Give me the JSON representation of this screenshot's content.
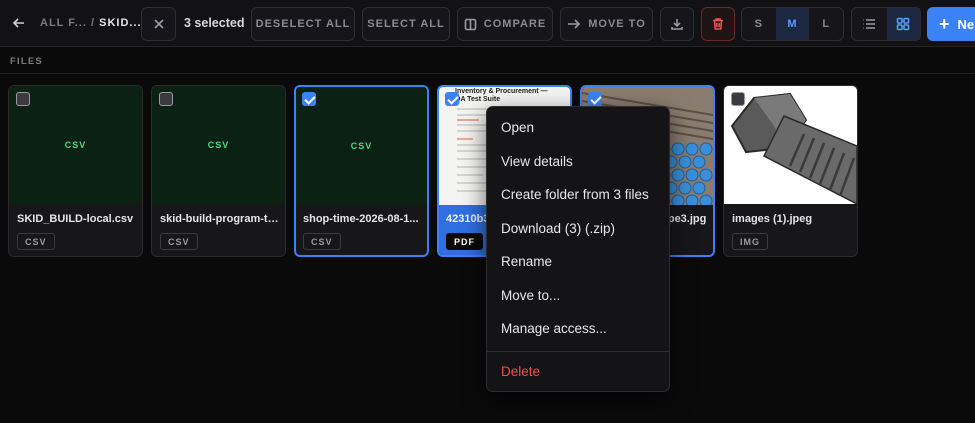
{
  "toolbar": {
    "breadcrumb_root": "ALL F...",
    "breadcrumb_sep": "/",
    "breadcrumb_current": "SKID...",
    "selected_count": "3 selected",
    "deselect_all": "DESELECT ALL",
    "select_all": "SELECT ALL",
    "compare": "COMPARE",
    "move_to": "MOVE TO",
    "size_s": "S",
    "size_m": "M",
    "size_l": "L",
    "new_label": "Ne",
    "accent": "#3b82f6",
    "delete_color": "#e5534b"
  },
  "section_label": "FILES",
  "files": [
    {
      "thumb_label": "CSV",
      "name": "SKID_BUILD-local.csv",
      "type": "CSV",
      "selected": false
    },
    {
      "thumb_label": "CSV",
      "name": "skid-build-program-ta...",
      "type": "CSV",
      "selected": false
    },
    {
      "thumb_label": "CSV",
      "name": "shop-time-2026-08-1...",
      "type": "CSV",
      "selected": true
    },
    {
      "thumb_title": "Inventory & Procurement — QA Test Suite",
      "name": "42310b35-0297-44b2-...",
      "type": "PDF",
      "selected": true
    },
    {
      "name": "carbon-steel-pipe3.jpg",
      "type": "IMG",
      "selected": true
    },
    {
      "name": "images (1).jpeg",
      "type": "IMG",
      "selected": false
    }
  ],
  "context_menu": {
    "items": [
      "Open",
      "View details",
      "Create folder from 3 files",
      "Download (3) (.zip)",
      "Rename",
      "Move to...",
      "Manage access..."
    ],
    "delete": "Delete"
  }
}
